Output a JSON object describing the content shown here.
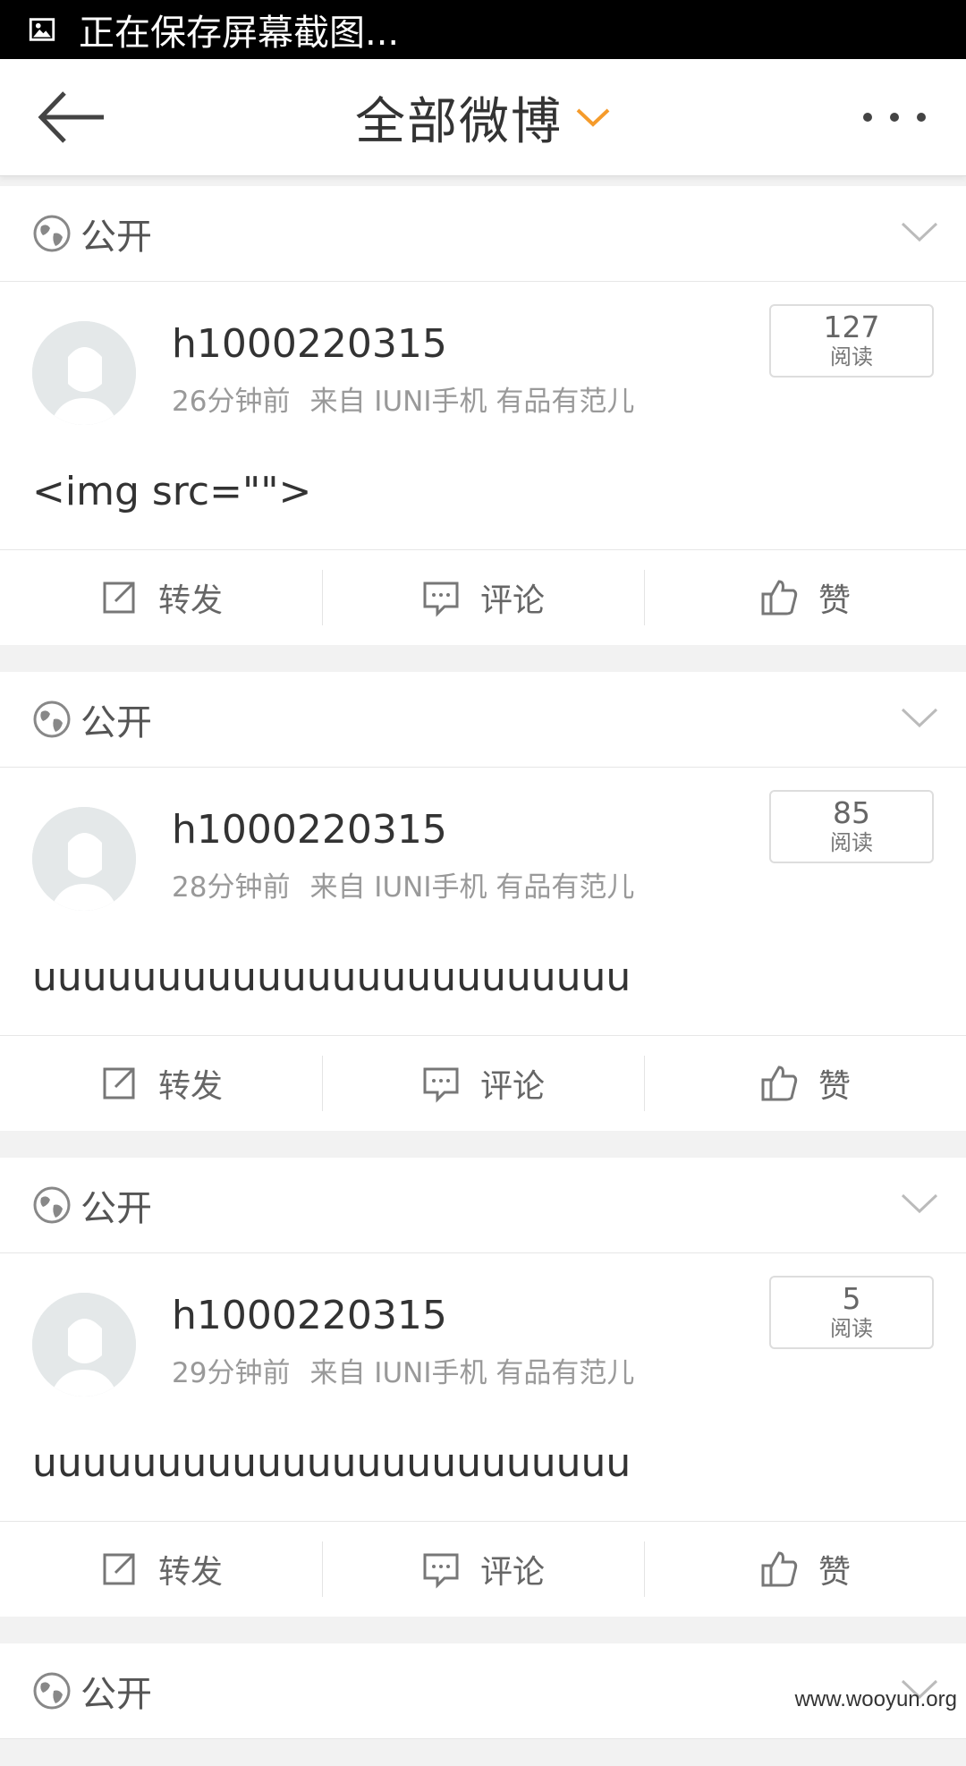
{
  "status_bar": {
    "text": "正在保存屏幕截图..."
  },
  "header": {
    "title": "全部微博",
    "accent_color": "#f59b2b"
  },
  "posts": [
    {
      "visibility": "公开",
      "username": "h1000220315",
      "time": "26分钟前",
      "source": "来自 IUNI手机 有品有范儿",
      "reads": "127",
      "reads_label": "阅读",
      "content": "<img src=\"\">",
      "actions": {
        "repost": "转发",
        "comment": "评论",
        "like": "赞"
      }
    },
    {
      "visibility": "公开",
      "username": "h1000220315",
      "time": "28分钟前",
      "source": "来自 IUNI手机 有品有范儿",
      "reads": "85",
      "reads_label": "阅读",
      "content": "uuuuuuuuuuuuuuuuuuuuuuuu",
      "actions": {
        "repost": "转发",
        "comment": "评论",
        "like": "赞"
      }
    },
    {
      "visibility": "公开",
      "username": "h1000220315",
      "time": "29分钟前",
      "source": "来自 IUNI手机 有品有范儿",
      "reads": "5",
      "reads_label": "阅读",
      "content": "uuuuuuuuuuuuuuuuuuuuuuuu",
      "actions": {
        "repost": "转发",
        "comment": "评论",
        "like": "赞"
      }
    },
    {
      "visibility": "公开"
    }
  ],
  "watermark": "www.wooyun.org"
}
